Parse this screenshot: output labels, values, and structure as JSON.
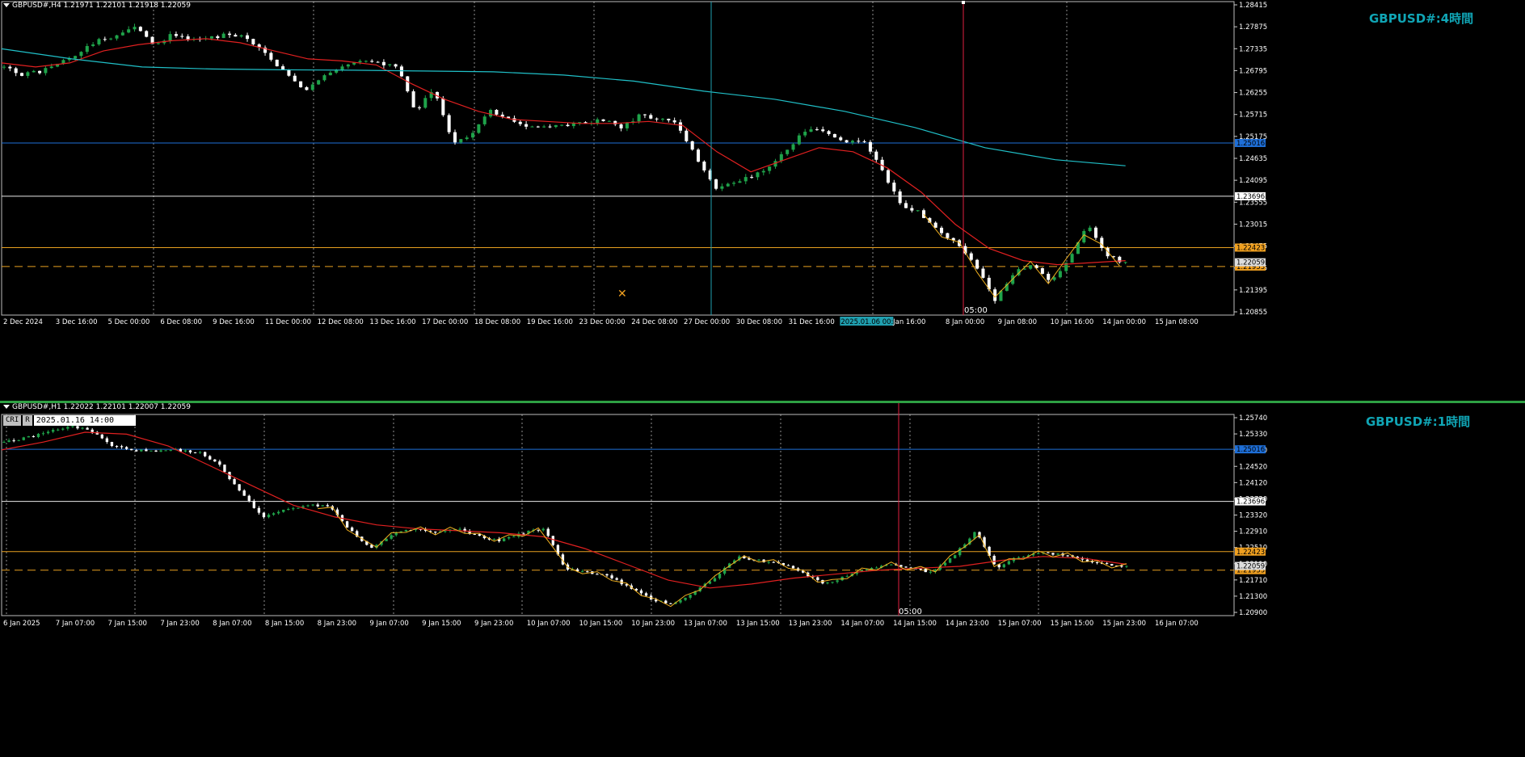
{
  "panels": [
    {
      "key": "h4",
      "header": "GBPUSD#,H4  1.21971 1.22101 1.21918 1.22059",
      "title": "GBPUSD#:4時間",
      "price_ticks": [
        "1.28415",
        "1.27875",
        "1.27335",
        "1.26795",
        "1.26255",
        "1.25715",
        "1.25175",
        "1.24635",
        "1.24095",
        "1.23555",
        "1.23015",
        "1.22475",
        "1.21935",
        "1.21395",
        "1.20855"
      ],
      "price_range": [
        1.2075,
        1.2852
      ],
      "time_labels": [
        "2 Dec 2024",
        "3 Dec 16:00",
        "5 Dec 00:00",
        "6 Dec 08:00",
        "9 Dec 16:00",
        "11 Dec 00:00",
        "12 Dec 08:00",
        "13 Dec 16:00",
        "17 Dec 00:00",
        "18 Dec 08:00",
        "19 Dec 16:00",
        "23 Dec 00:00",
        "24 Dec 08:00",
        "27 Dec 00:00",
        "30 Dec 08:00",
        "31 Dec 16:00",
        "2025.01.06 00:00",
        "Jan 16:00",
        "8 Jan 00:00",
        "9 Jan 08:00",
        "10 Jan 16:00",
        "14 Jan 00:00",
        "15 Jan 08:00"
      ],
      "highlight_time": "2025.01.06 00:00",
      "hlines": [
        {
          "price": 1.25016,
          "label": "1.25016",
          "color": "#1e6fd8",
          "tag_color": "#1e6fd8",
          "style": "solid"
        },
        {
          "price": 1.23696,
          "label": "1.23696",
          "color": "#e8e8e8",
          "tag_color": "#ffffff",
          "style": "solid"
        },
        {
          "price": 1.22423,
          "label": "1.22423",
          "color": "#e8a020",
          "tag_color": "#f0a020",
          "style": "solid"
        },
        {
          "price": 1.21953,
          "label": "1.21953",
          "color": "#e8a020",
          "tag_color": "#f0a020",
          "style": "dashed"
        }
      ],
      "current_price": "1.22059",
      "vline_label": "05:00"
    },
    {
      "key": "h1",
      "header": "GBPUSD#,H1  1.22022 1.22101 1.22007 1.22059",
      "title": "GBPUSD#:1時間",
      "datetime_box": "2025.01.16 14:00",
      "ctrl_buttons": [
        "CRI",
        "R"
      ],
      "price_ticks": [
        "1.25740",
        "1.25330",
        "1.24930",
        "1.24520",
        "1.24120",
        "1.23720",
        "1.23320",
        "1.22910",
        "1.22510",
        "1.22110",
        "1.21710",
        "1.21300",
        "1.20900"
      ],
      "price_range": [
        1.208,
        1.259
      ],
      "time_labels": [
        "6 Jan 2025",
        "7 Jan 07:00",
        "7 Jan 15:00",
        "7 Jan 23:00",
        "8 Jan 07:00",
        "8 Jan 15:00",
        "8 Jan 23:00",
        "9 Jan 07:00",
        "9 Jan 15:00",
        "9 Jan 23:00",
        "10 Jan 07:00",
        "10 Jan 15:00",
        "10 Jan 23:00",
        "13 Jan 07:00",
        "13 Jan 15:00",
        "13 Jan 23:00",
        "14 Jan 07:00",
        "14 Jan 15:00",
        "14 Jan 23:00",
        "15 Jan 07:00",
        "15 Jan 15:00",
        "15 Jan 23:00",
        "16 Jan 07:00"
      ],
      "hlines": [
        {
          "price": 1.25016,
          "label": "1.25016",
          "color": "#1e6fd8",
          "tag_color": "#1e6fd8",
          "style": "solid"
        },
        {
          "price": 1.23696,
          "label": "1.23696",
          "color": "#e8e8e8",
          "tag_color": "#ffffff",
          "style": "solid"
        },
        {
          "price": 1.22423,
          "label": "1.22423",
          "color": "#e8a020",
          "tag_color": "#f0a020",
          "style": "solid"
        },
        {
          "price": 1.21953,
          "label": "1.21953",
          "color": "#e8a020",
          "tag_color": "#f0a020",
          "style": "dashed"
        }
      ],
      "current_price": "1.22059",
      "vline_label": "05:00"
    }
  ],
  "colors": {
    "up": "#1fa34a",
    "down": "#ffffff",
    "ma_fast": "#e02020",
    "ma_slow": "#20c0c8",
    "zigzag": "#f0b020",
    "grid": "#cfcfcf",
    "vline_red": "#e02040",
    "vline_cyan": "#20a0b0"
  },
  "chart_data": [
    {
      "type": "candlestick",
      "title": "GBPUSD#:4時間",
      "timeframe": "H4",
      "ylim": [
        1.2085,
        1.2842
      ],
      "close_path": [
        1.269,
        1.267,
        1.268,
        1.27,
        1.2725,
        1.2755,
        1.2765,
        1.279,
        1.2745,
        1.277,
        1.2755,
        1.276,
        1.2775,
        1.276,
        1.272,
        1.268,
        1.263,
        1.2665,
        1.269,
        1.271,
        1.27,
        1.2695,
        1.258,
        1.264,
        1.25,
        1.252,
        1.258,
        1.256,
        1.254,
        1.254,
        1.2545,
        1.255,
        1.256,
        1.254,
        1.257,
        1.256,
        1.255,
        1.247,
        1.239,
        1.24,
        1.242,
        1.244,
        1.249,
        1.254,
        1.253,
        1.25,
        1.251,
        1.243,
        1.235,
        1.233,
        1.228,
        1.225,
        1.22,
        1.211,
        1.218,
        1.22,
        1.216,
        1.2215,
        1.23,
        1.222,
        1.2206
      ],
      "ma_fast_path": [
        1.27,
        1.269,
        1.27,
        1.273,
        1.2745,
        1.2755,
        1.276,
        1.275,
        1.273,
        1.271,
        1.2705,
        1.2695,
        1.265,
        1.261,
        1.258,
        1.256,
        1.2555,
        1.255,
        1.255,
        1.2555,
        1.2545,
        1.248,
        1.243,
        1.246,
        1.249,
        1.248,
        1.244,
        1.238,
        1.23,
        1.224,
        1.221,
        1.22,
        1.2205,
        1.221
      ],
      "ma_slow_path": [
        1.2735,
        1.271,
        1.269,
        1.2685,
        1.2683,
        1.2682,
        1.268,
        1.2678,
        1.267,
        1.2655,
        1.263,
        1.261,
        1.258,
        1.254,
        1.249,
        1.246,
        1.2445
      ],
      "hlines": [
        1.25016,
        1.23696,
        1.22423,
        1.21953
      ]
    },
    {
      "type": "candlestick",
      "title": "GBPUSD#:1時間",
      "timeframe": "H1",
      "ylim": [
        1.209,
        1.2574
      ],
      "close_path": [
        1.252,
        1.253,
        1.2545,
        1.256,
        1.255,
        1.251,
        1.25,
        1.2495,
        1.25,
        1.2495,
        1.246,
        1.239,
        1.233,
        1.235,
        1.236,
        1.236,
        1.23,
        1.225,
        1.2285,
        1.23,
        1.229,
        1.23,
        1.228,
        1.227,
        1.229,
        1.23,
        1.22,
        1.219,
        1.218,
        1.215,
        1.212,
        1.211,
        1.214,
        1.218,
        1.223,
        1.222,
        1.221,
        1.219,
        1.216,
        1.218,
        1.22,
        1.221,
        1.22,
        1.219,
        1.223,
        1.2295,
        1.22,
        1.223,
        1.224,
        1.2235,
        1.222,
        1.221,
        1.2205
      ],
      "ma_fast_path": [
        1.25,
        1.252,
        1.2545,
        1.254,
        1.251,
        1.246,
        1.241,
        1.236,
        1.233,
        1.231,
        1.23,
        1.2295,
        1.229,
        1.228,
        1.225,
        1.221,
        1.217,
        1.215,
        1.216,
        1.2175,
        1.2185,
        1.2195,
        1.22,
        1.2205,
        1.222,
        1.223,
        1.2225,
        1.221
      ],
      "hlines": [
        1.25016,
        1.23696,
        1.22423,
        1.21953
      ]
    }
  ]
}
